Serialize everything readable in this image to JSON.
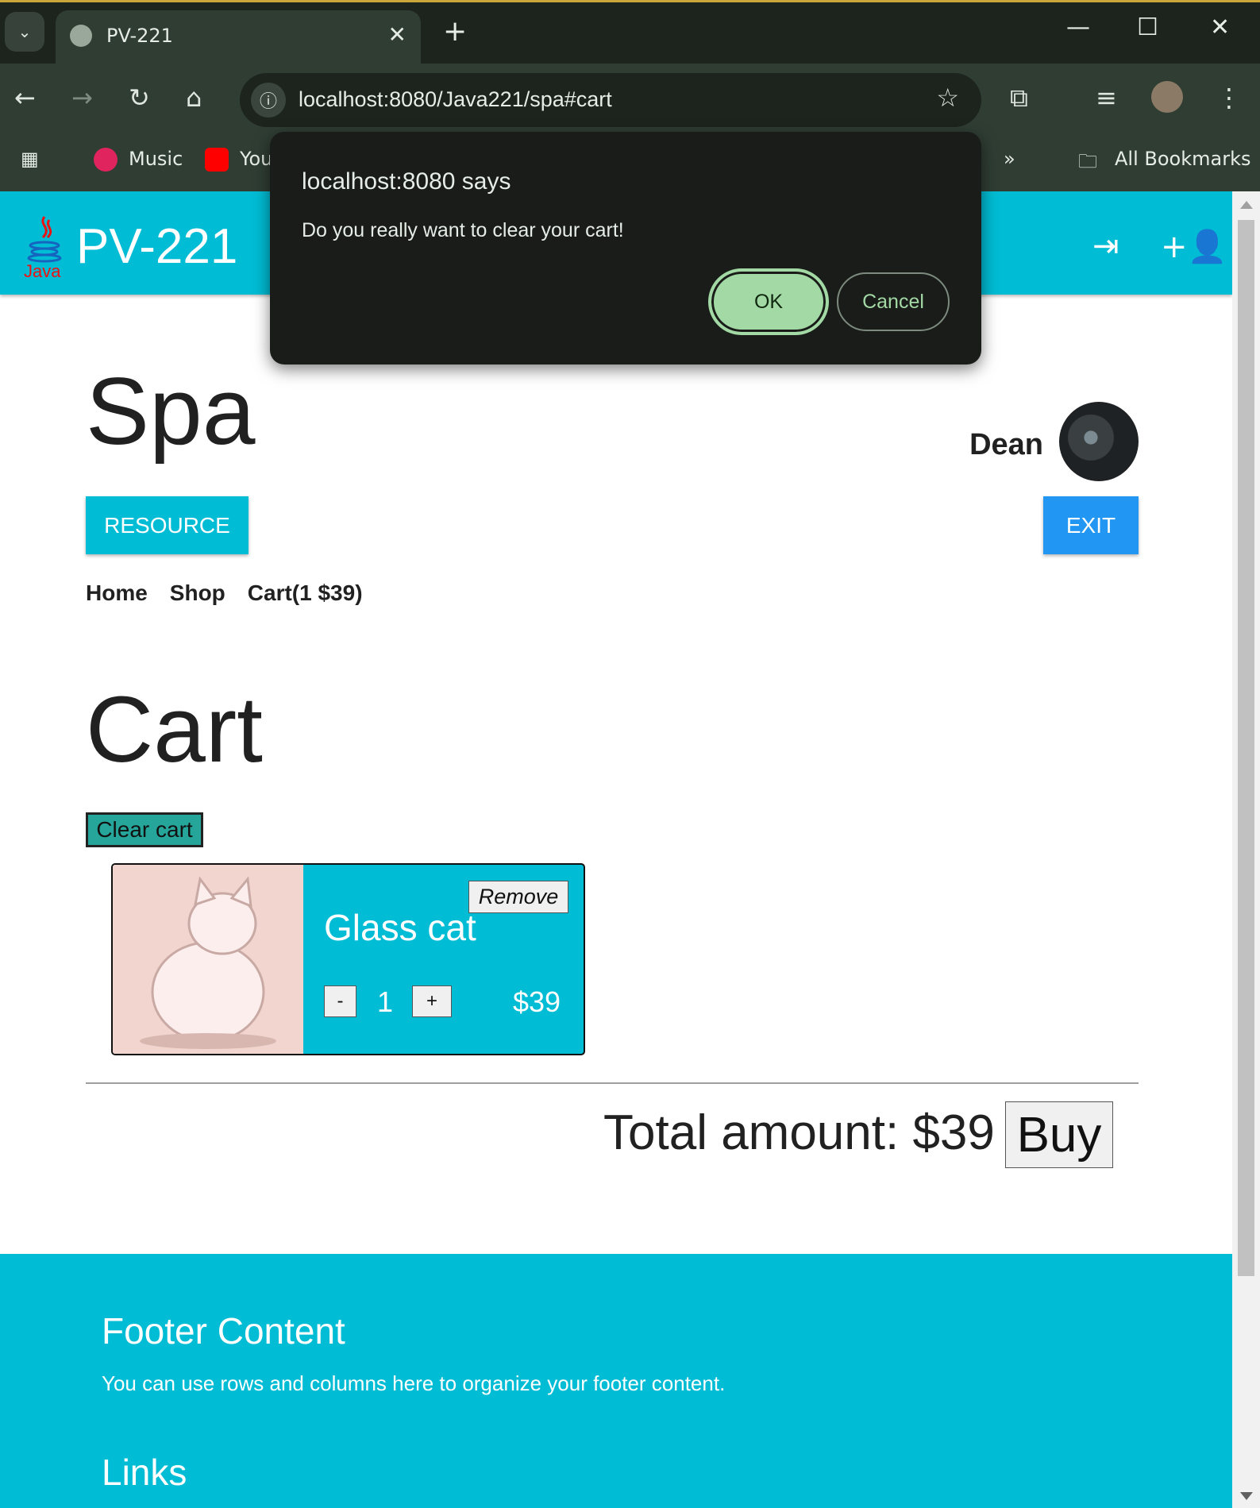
{
  "browser": {
    "tab_title": "PV-221",
    "url": "localhost:8080/Java221/spa#cart",
    "bookmarks": [
      "Music",
      "You"
    ],
    "all_bookmarks": "All Bookmarks"
  },
  "navbar": {
    "brand": "PV-221",
    "logo_text": "Java"
  },
  "page": {
    "title": "Spa",
    "username": "Dean",
    "resource_button": "RESOURCE",
    "exit_button": "EXIT",
    "menu": [
      "Home",
      "Shop",
      "Cart(1 $39)"
    ],
    "cart_heading": "Cart",
    "clear_button": "Clear cart",
    "cart_items": [
      {
        "name": "Glass cat",
        "quantity": "1",
        "price": "$39",
        "remove_label": "Remove",
        "minus": "-",
        "plus": "+"
      }
    ],
    "total_label": "Total amount: $39",
    "buy_button": "Buy"
  },
  "footer": {
    "title": "Footer Content",
    "text": "You can use rows and columns here to organize your footer content.",
    "links_title": "Links"
  },
  "dialog": {
    "title": "localhost:8080 says",
    "message": "Do you really want to clear your cart!",
    "ok": "OK",
    "cancel": "Cancel"
  },
  "colors": {
    "navbar": "#00bcd4",
    "exit": "#2196f3",
    "clear": "#26a69a",
    "dialog_ok": "#a3d9a5"
  }
}
